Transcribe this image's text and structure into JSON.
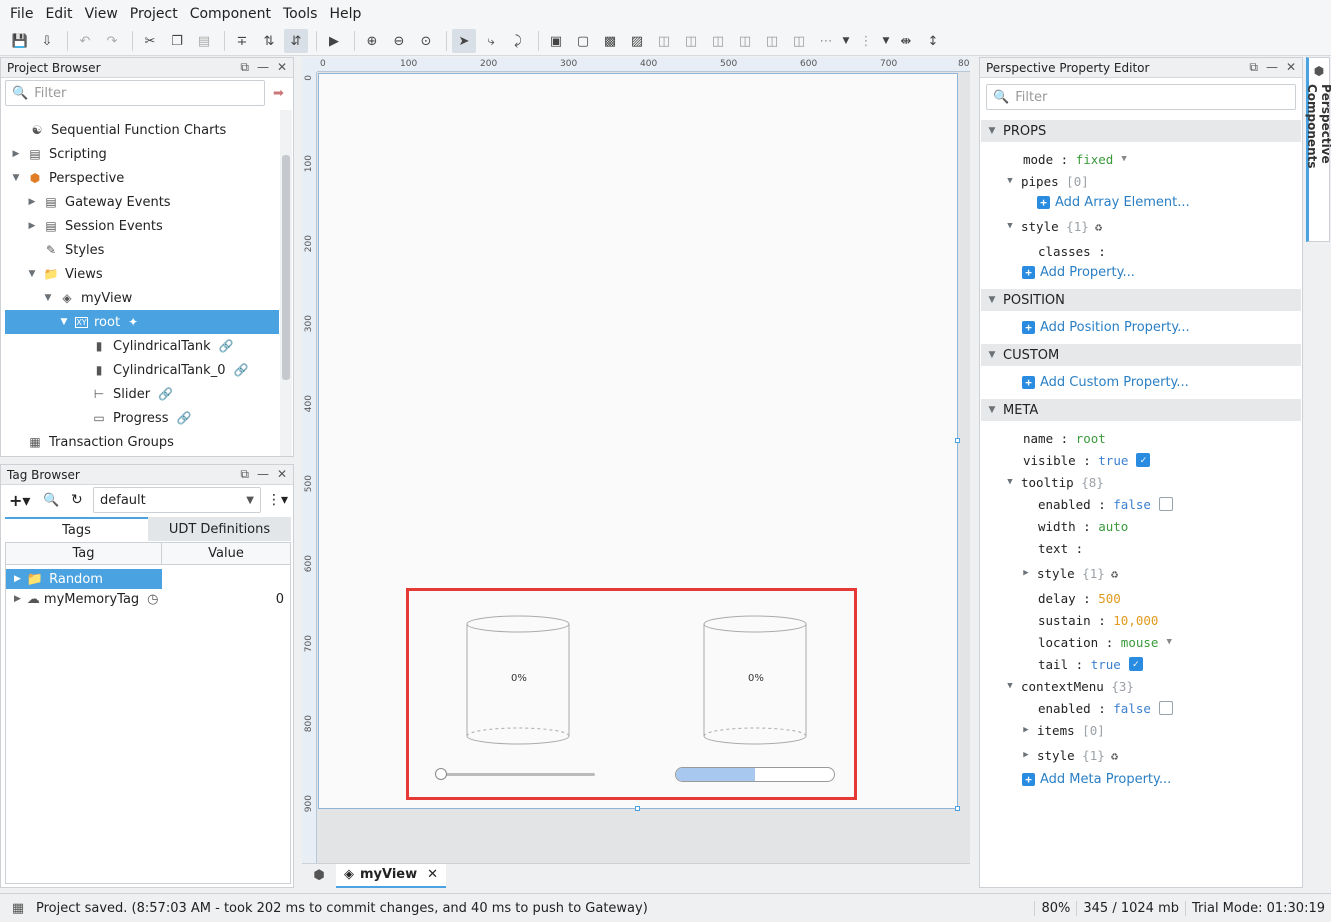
{
  "menu": [
    "File",
    "Edit",
    "View",
    "Project",
    "Component",
    "Tools",
    "Help"
  ],
  "project_browser": {
    "title": "Project Browser",
    "filter_placeholder": "Filter",
    "items": [
      "Sequential Function Charts",
      "Scripting",
      "Perspective",
      "Gateway Events",
      "Session Events",
      "Styles",
      "Views",
      "myView",
      "root",
      "CylindricalTank",
      "CylindricalTank_0",
      "Slider",
      "Progress",
      "Transaction Groups"
    ]
  },
  "tag_browser": {
    "title": "Tag Browser",
    "provider": "default",
    "tabs": [
      "Tags",
      "UDT Definitions"
    ],
    "columns": [
      "Tag",
      "Value"
    ],
    "rows": [
      {
        "name": "Random",
        "value": ""
      },
      {
        "name": "myMemoryTag",
        "value": "0"
      }
    ]
  },
  "designer": {
    "ruler_h": [
      "0",
      "100",
      "200",
      "300",
      "400",
      "500",
      "600",
      "700",
      "80"
    ],
    "ruler_v": [
      "0",
      "100",
      "200",
      "300",
      "400",
      "500",
      "600",
      "700",
      "800",
      "900"
    ],
    "tank1_label": "0%",
    "tank2_label": "0%",
    "slider_value_fraction": 0.0,
    "progress_fraction": 0.5,
    "highlight_color": "#e53935",
    "tab_label": "myView"
  },
  "property_editor": {
    "title": "Perspective Property Editor",
    "filter_placeholder": "Filter",
    "side_tab": "Perspective Components",
    "sections": {
      "props": "PROPS",
      "position": "POSITION",
      "custom": "CUSTOM",
      "meta": "META"
    },
    "props": {
      "mode_key": "mode",
      "mode_val": "fixed",
      "pipes_key": "pipes",
      "pipes_count": "[0]",
      "add_array": "Add Array Element...",
      "style_key": "style",
      "style_count": "{1}",
      "classes_key": "classes",
      "add_property": "Add Property..."
    },
    "add_position": "Add Position Property...",
    "add_custom": "Add Custom Property...",
    "meta": {
      "name_key": "name",
      "name_val": "root",
      "visible_key": "visible",
      "visible_val": "true",
      "tooltip_key": "tooltip",
      "tooltip_count": "{8}",
      "enabled_key": "enabled",
      "enabled_val": "false",
      "width_key": "width",
      "width_val": "auto",
      "text_key": "text",
      "style_key": "style",
      "style_count": "{1}",
      "delay_key": "delay",
      "delay_val": "500",
      "sustain_key": "sustain",
      "sustain_val": "10,000",
      "location_key": "location",
      "location_val": "mouse",
      "tail_key": "tail",
      "tail_val": "true",
      "context_key": "contextMenu",
      "context_count": "{3}",
      "cm_enabled_key": "enabled",
      "cm_enabled_val": "false",
      "items_key": "items",
      "items_count": "[0]",
      "cm_style_key": "style",
      "cm_style_count": "{1}",
      "add_meta": "Add Meta Property..."
    }
  },
  "status": {
    "message": "Project saved. (8:57:03 AM - took 202 ms to commit changes, and 40 ms to push to Gateway)",
    "zoom": "80%",
    "memory": "345 / 1024 mb",
    "trial": "Trial Mode: 01:30:19"
  }
}
